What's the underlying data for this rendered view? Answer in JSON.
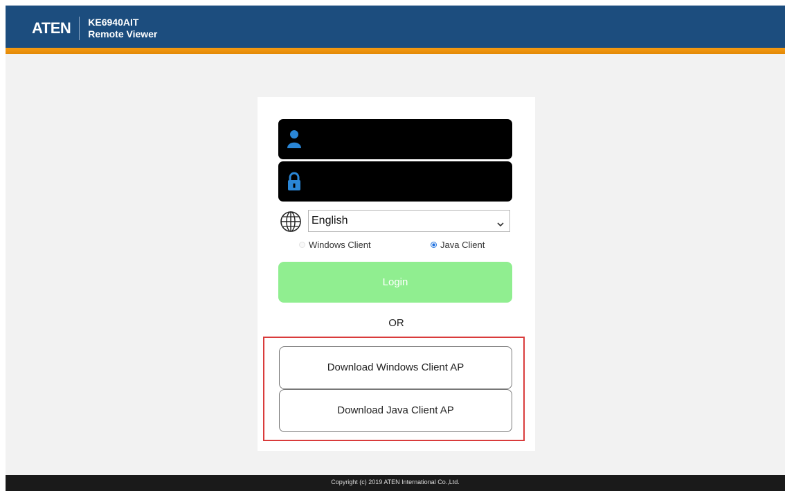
{
  "header": {
    "logo": "ATEN",
    "model": "KE6940AIT",
    "product": "Remote Viewer",
    "bar_color": "#1c4d7e",
    "accent_color": "#f59a12"
  },
  "login": {
    "username_icon": "user-icon",
    "password_icon": "lock-icon",
    "username_value": "",
    "password_value": "",
    "language_icon": "globe-icon",
    "language_selected": "English",
    "client_options": [
      {
        "label": "Windows Client",
        "selected": false
      },
      {
        "label": "Java Client",
        "selected": true
      }
    ],
    "login_label": "Login",
    "login_color": "#90ee90",
    "or_label": "OR"
  },
  "downloads": {
    "windows_label": "Download Windows Client AP",
    "java_label": "Download Java Client AP",
    "highlight_color": "#d93b3b"
  },
  "footer": {
    "copyright": "Copyright (c) 2019 ATEN International Co.,Ltd."
  }
}
